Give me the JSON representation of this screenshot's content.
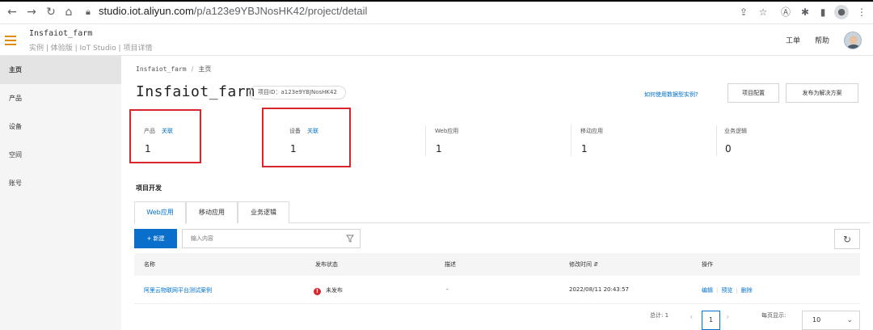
{
  "browser": {
    "url_host": "studio.iot.aliyun.com",
    "url_path": "/p/a123e9YBJNosHK42/project/detail"
  },
  "header": {
    "title": "Insfaiot_farm",
    "subtitle": "实例 | 体验版 | IoT Studio | 项目详情",
    "links": [
      "工单",
      "帮助"
    ]
  },
  "sidebar": {
    "items": [
      {
        "label": "主页",
        "active": true
      },
      {
        "label": "产品",
        "active": false
      },
      {
        "label": "设备",
        "active": false
      },
      {
        "label": "空间",
        "active": false
      },
      {
        "label": "账号",
        "active": false
      }
    ]
  },
  "breadcrumb": {
    "items": [
      "Insfaiot_farm",
      "主页"
    ]
  },
  "project": {
    "title": "Insfaiot_farm",
    "id_label": "项目ID：a123e9YBJNosHK42",
    "help_link": "如何使用数据型实例?",
    "settings_button": "项目配置",
    "publish_button": "发布为解决方案"
  },
  "stats": [
    {
      "label": "产品",
      "link": "关联",
      "value": "1"
    },
    {
      "label": "设备",
      "link": "关联",
      "value": "1"
    },
    {
      "label": "Web应用",
      "link": "",
      "value": "1"
    },
    {
      "label": "移动应用",
      "link": "",
      "value": "1"
    },
    {
      "label": "业务逻辑",
      "link": "",
      "value": "0"
    }
  ],
  "section": {
    "title": "项目开发"
  },
  "tabs": [
    {
      "label": "Web应用",
      "active": true
    },
    {
      "label": "移动应用",
      "active": false
    },
    {
      "label": "业务逻辑",
      "active": false
    }
  ],
  "toolbar": {
    "new_label": "+ 新建",
    "search_placeholder": "输入内容"
  },
  "table": {
    "columns": [
      "名称",
      "发布状态",
      "描述",
      "修改时间 ⇵",
      "操作"
    ],
    "rows": [
      {
        "name": "阿里云物联网平台测试案例",
        "status": "未发布",
        "desc": "-",
        "modified": "2022/08/11 20:43:57",
        "actions": [
          "编辑",
          "预览",
          "删除"
        ]
      }
    ]
  },
  "pagination": {
    "total_label": "总计: 1",
    "current_page": "1",
    "page_size_label": "每页显示:",
    "page_size": "10"
  },
  "colors": {
    "accent": "#0070cc",
    "primary_button": "#0a6fca",
    "highlight_border": "#d9262c",
    "menu_icon": "#e08a00"
  }
}
